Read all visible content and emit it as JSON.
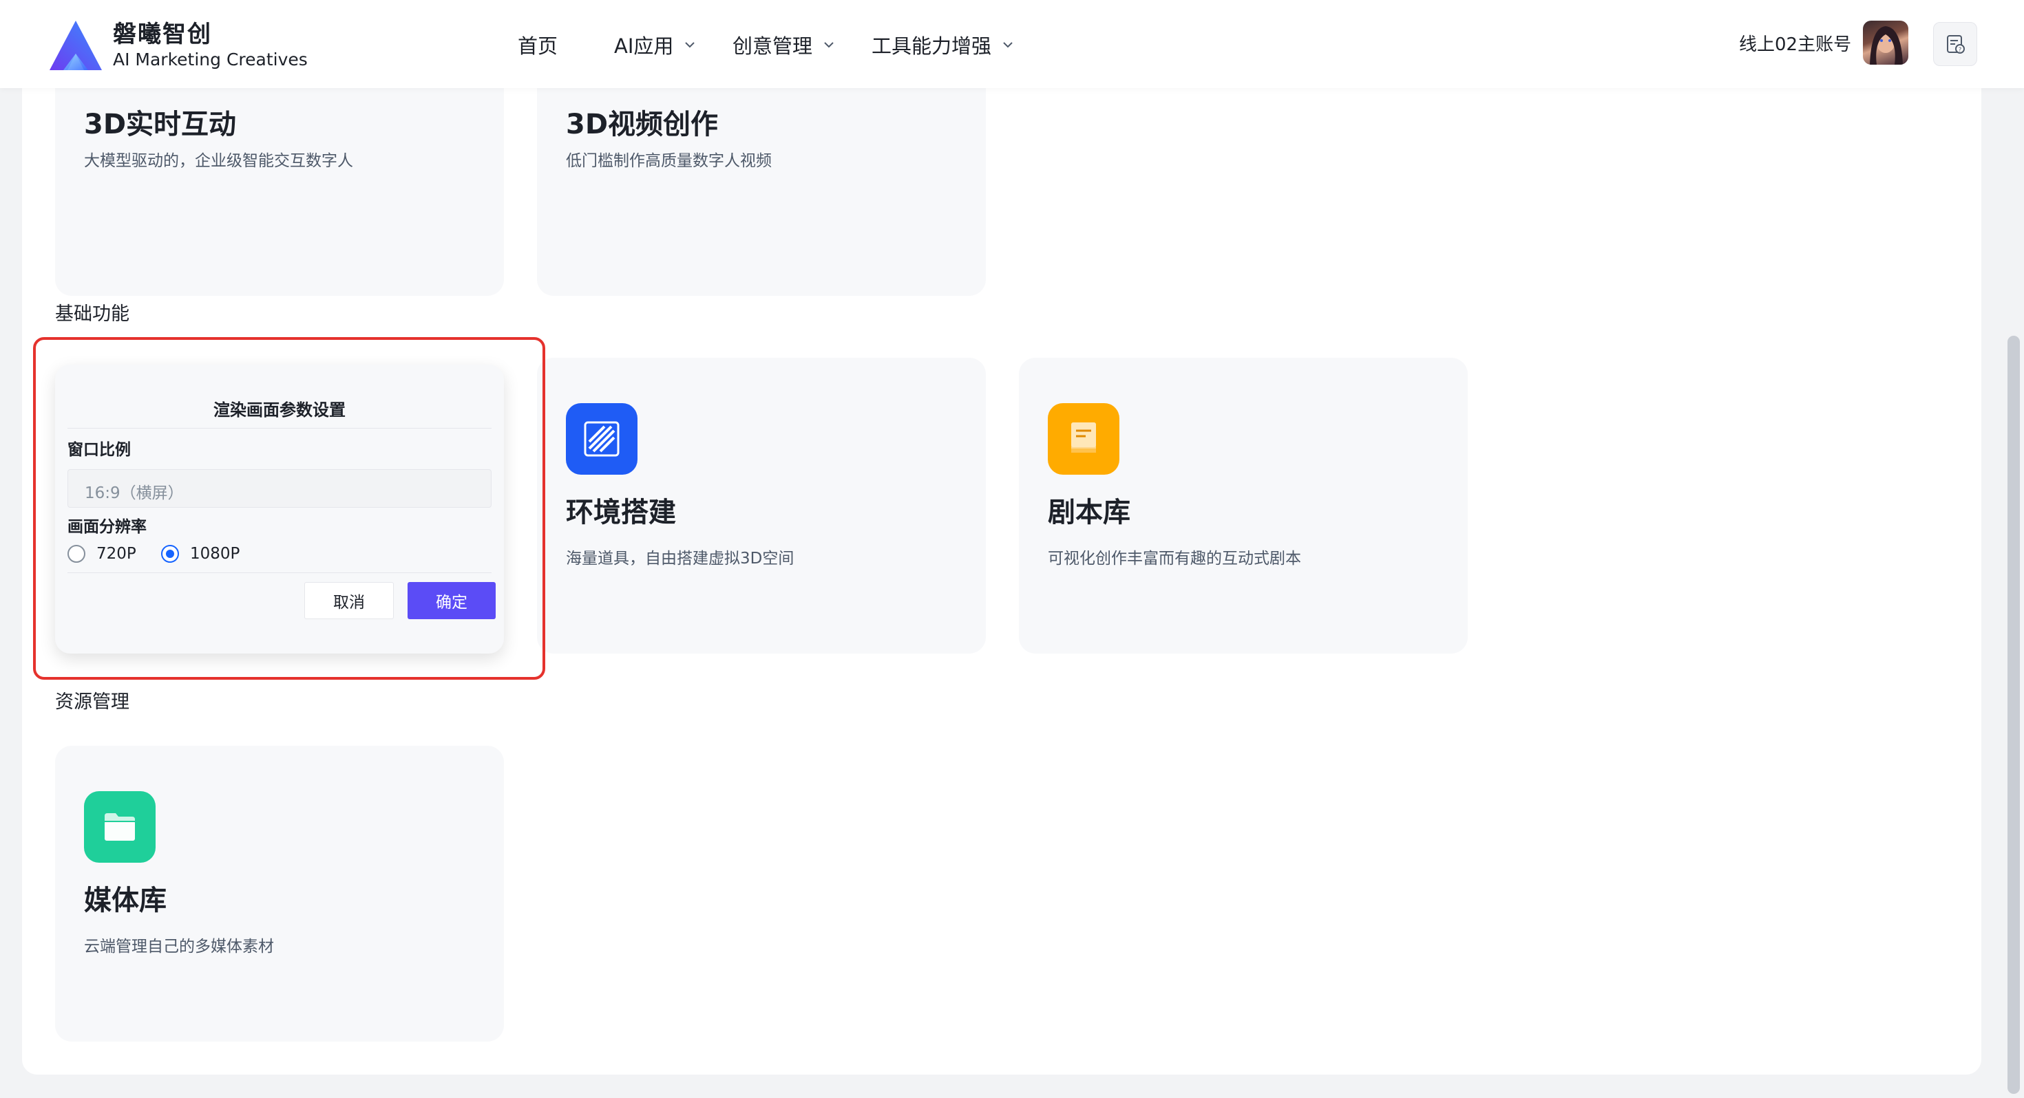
{
  "header": {
    "brand_name": "磐曦智创",
    "brand_sub": "AI Marketing Creatives",
    "nav": [
      {
        "label": "首页",
        "has_dropdown": false
      },
      {
        "label": "AI应用",
        "has_dropdown": true
      },
      {
        "label": "创意管理",
        "has_dropdown": true
      },
      {
        "label": "工具能力增强",
        "has_dropdown": true
      }
    ],
    "user_name": "线上02主账号",
    "help_icon": "help-document-icon"
  },
  "top_cards": [
    {
      "title": "3D实时互动",
      "desc": "大模型驱动的，企业级智能交互数字人"
    },
    {
      "title": "3D视频创作",
      "desc": "低门槛制作高质量数字人视频"
    }
  ],
  "sections": {
    "basic": "基础功能",
    "resources": "资源管理"
  },
  "basic_cards": [
    {
      "title": "环境搭建",
      "desc": "海量道具，自由搭建虚拟3D空间",
      "icon": "environment-stripes-icon",
      "icon_color": "#1f5cf5"
    },
    {
      "title": "剧本库",
      "desc": "可视化创作丰富而有趣的互动式剧本",
      "icon": "script-book-icon",
      "icon_color": "#ffab00"
    }
  ],
  "resource_cards": [
    {
      "title": "媒体库",
      "desc": "云端管理自己的多媒体素材",
      "icon": "folder-icon",
      "icon_color": "#1fcf9a"
    }
  ],
  "dialog": {
    "title": "渲染画面参数设置",
    "ratio_label": "窗口比例",
    "ratio_value": "16:9（横屏）",
    "resolution_label": "画面分辨率",
    "options": [
      "720P",
      "1080P"
    ],
    "selected": "1080P",
    "cancel": "取消",
    "confirm": "确定"
  },
  "colors": {
    "accent": "#5b4cf6",
    "radio_active": "#1664ff",
    "highlight_border": "#e5322d"
  }
}
